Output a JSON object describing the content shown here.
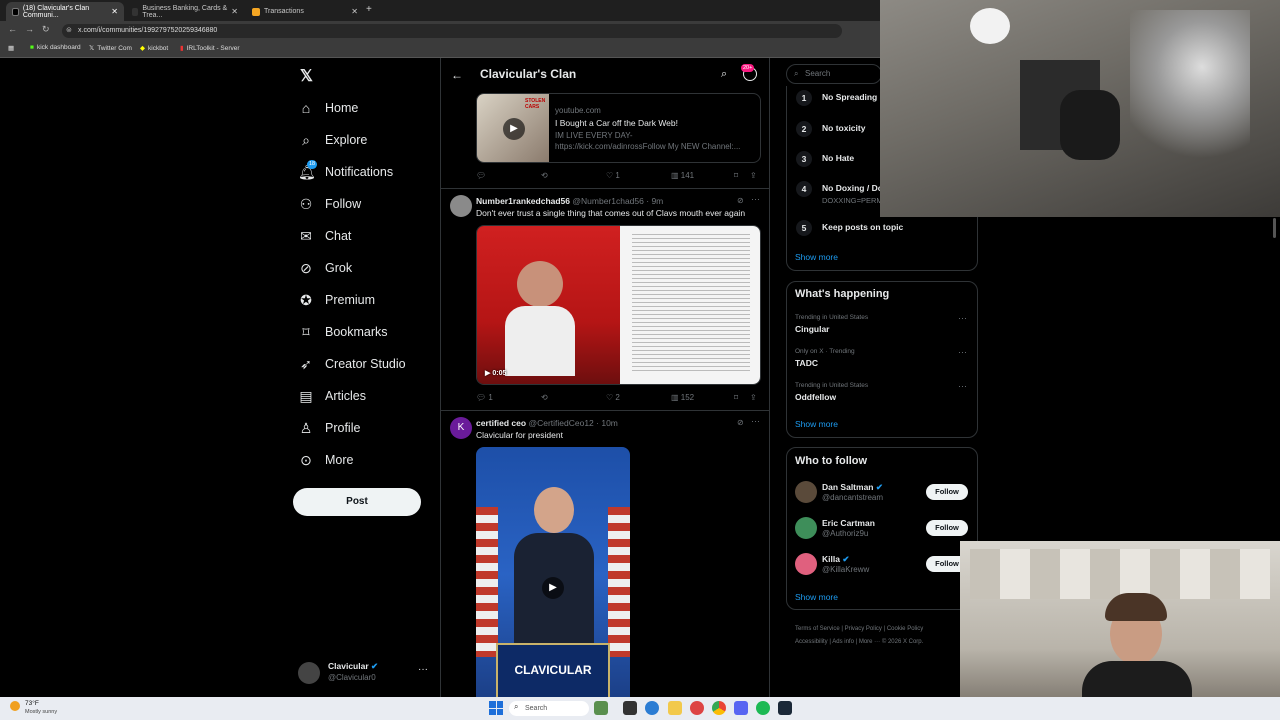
{
  "browser": {
    "tabs": [
      {
        "label": "(18) Clavicular's Clan Communi..."
      },
      {
        "label": "Business Banking, Cards & Trea..."
      },
      {
        "label": "Transactions"
      }
    ],
    "url": "x.com/i/communities/1992797520259346880",
    "bookmarks": [
      "kick dashboard",
      "Twitter Com",
      "kickbot",
      "IRLToolkit - Server"
    ]
  },
  "nav": {
    "items": [
      {
        "label": "Home",
        "icon": "home-icon"
      },
      {
        "label": "Explore",
        "icon": "search-icon"
      },
      {
        "label": "Notifications",
        "icon": "bell-icon",
        "badge": "18"
      },
      {
        "label": "Follow",
        "icon": "add-person-icon"
      },
      {
        "label": "Chat",
        "icon": "mail-icon"
      },
      {
        "label": "Grok",
        "icon": "grok-icon"
      },
      {
        "label": "Premium",
        "icon": "premium-icon"
      },
      {
        "label": "Bookmarks",
        "icon": "bookmark-icon"
      },
      {
        "label": "Creator Studio",
        "icon": "rocket-icon"
      },
      {
        "label": "Articles",
        "icon": "article-icon"
      },
      {
        "label": "Profile",
        "icon": "person-icon"
      },
      {
        "label": "More",
        "icon": "more-icon"
      }
    ],
    "post_label": "Post",
    "account": {
      "name": "Clavicular",
      "handle": "@Clavicular0"
    }
  },
  "feed": {
    "title": "Clavicular's Clan",
    "badge": "20+",
    "link_card": {
      "domain": "youtube.com",
      "title": "I Bought a Car off the Dark Web!",
      "desc1": "IM LIVE EVERY DAY-",
      "desc2": "https://kick.com/adinrossFollow My NEW Channel:...",
      "thumb_text": "STOLEN CARS"
    },
    "post0_actions": {
      "replies": "",
      "reposts": "",
      "likes": "1",
      "views": "141"
    },
    "post1": {
      "name": "Number1rankedchad56",
      "handle": "@Number1chad56",
      "time": "· 9m",
      "text": "Don't ever trust a single thing that comes out of Clavs mouth ever again",
      "duration": "0:05",
      "replies": "1",
      "reposts": "",
      "likes": "2",
      "views": "152"
    },
    "post2": {
      "avatar_letter": "K",
      "name": "certified ceo",
      "handle": "@CertifiedCeo12",
      "time": "· 10m",
      "text": "Clavicular for president",
      "podium": "CLAVICULAR"
    }
  },
  "sidebar": {
    "search_placeholder": "Search",
    "rules": [
      {
        "n": "1",
        "label": "No Spreading M"
      },
      {
        "n": "2",
        "label": "No toxicity"
      },
      {
        "n": "3",
        "label": "No Hate"
      },
      {
        "n": "4",
        "label": "No Doxing / Do",
        "sub": "DOXXING=PERM"
      },
      {
        "n": "5",
        "label": "Keep posts on topic"
      }
    ],
    "show_more": "Show more",
    "happening_title": "What's happening",
    "trends": [
      {
        "context": "Trending in United States",
        "name": "Cingular"
      },
      {
        "context": "Only on X · Trending",
        "name": "TADC"
      },
      {
        "context": "Trending in United States",
        "name": "Oddfellow"
      }
    ],
    "wtf_title": "Who to follow",
    "wtf": [
      {
        "name": "Dan Saltman",
        "handle": "@dancantstream",
        "follow": "Follow"
      },
      {
        "name": "Eric Cartman",
        "handle": "@Authoriz9u",
        "follow": "Follow"
      },
      {
        "name": "Killa",
        "handle": "@KillaKreww",
        "follow": "Follow"
      }
    ],
    "footer": [
      "Terms of Service",
      "Privacy Policy",
      "Cookie Policy",
      "Accessibility",
      "Ads info",
      "More ···",
      "© 2026 X Corp."
    ]
  },
  "taskbar": {
    "weather_temp": "73°F",
    "weather_desc": "Mostly sunny",
    "search": "Search"
  },
  "colors": {
    "accent": "#1d9bf0",
    "background": "#000000",
    "border": "#2f3336",
    "muted": "#71767b"
  }
}
